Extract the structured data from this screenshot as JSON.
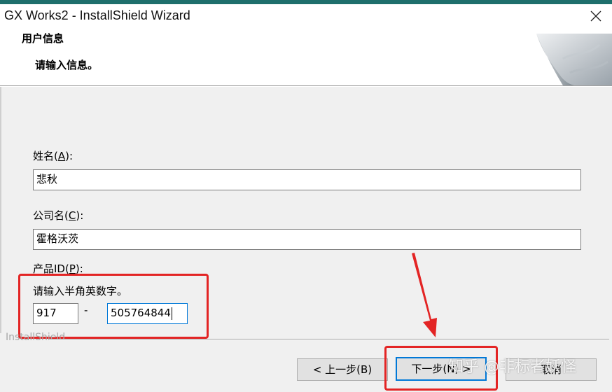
{
  "window": {
    "title": "GX Works2 - InstallShield Wizard",
    "close_icon": "close-icon"
  },
  "header": {
    "title": "用户信息",
    "subtitle": "请输入信息。"
  },
  "form": {
    "name_label_prefix": "姓名(",
    "name_label_key": "A",
    "name_label_suffix": "):",
    "name_value": "悲秋",
    "company_label_prefix": "公司名(",
    "company_label_key": "C",
    "company_label_suffix": "):",
    "company_value": "霍格沃茨",
    "product_label_prefix": "产品ID(",
    "product_label_key": "P",
    "product_label_suffix": "):",
    "product_hint": "请输入半角英数字。",
    "product_id_part1": "917",
    "product_id_separator": "-",
    "product_id_part2": "505764844"
  },
  "footer": {
    "brand": "InstallShield",
    "back_label": "< 上一步(B)",
    "next_label": "下一步(N) >",
    "cancel_label": "取消"
  },
  "watermark": "知乎 @非标者妖怪",
  "colors": {
    "annotation": "#e32424",
    "accent": "#0078d7",
    "titlebar_strip": "#1e6f6c"
  }
}
